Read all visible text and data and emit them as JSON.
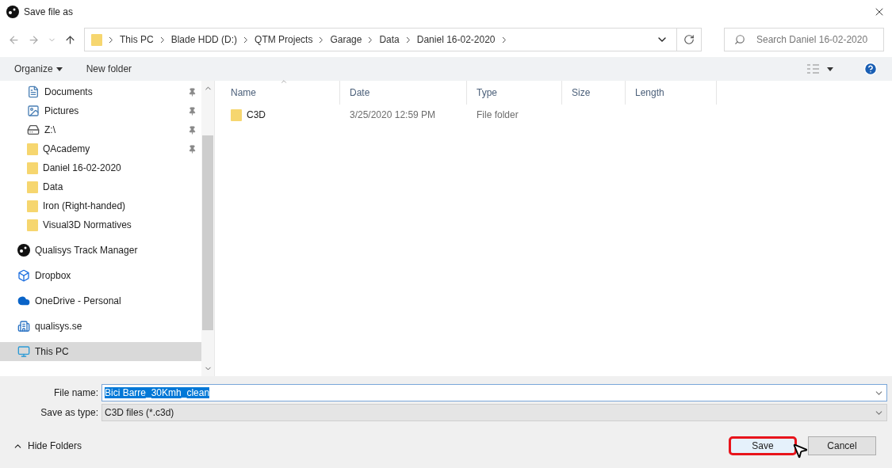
{
  "window": {
    "title": "Save file as"
  },
  "address": {
    "crumbs": [
      "This PC",
      "Blade HDD (D:)",
      "QTM Projects",
      "Garage",
      "Data",
      "Daniel 16-02-2020"
    ]
  },
  "search": {
    "placeholder": "Search Daniel 16-02-2020"
  },
  "toolbar": {
    "organize": "Organize",
    "new_folder": "New folder"
  },
  "sidebar": {
    "quick_access": [
      {
        "label": "Documents",
        "kind": "document",
        "pinned": true
      },
      {
        "label": "Pictures",
        "kind": "pictures",
        "pinned": true
      },
      {
        "label": "Z:\\",
        "kind": "drive",
        "pinned": true
      },
      {
        "label": "QAcademy",
        "kind": "folder",
        "pinned": true
      },
      {
        "label": "Daniel 16-02-2020",
        "kind": "folder",
        "pinned": false
      },
      {
        "label": "Data",
        "kind": "folder",
        "pinned": false
      },
      {
        "label": "Iron (Right-handed)",
        "kind": "folder",
        "pinned": false
      },
      {
        "label": "Visual3D Normatives",
        "kind": "folder",
        "pinned": false
      }
    ],
    "locations": [
      {
        "label": "Qualisys Track Manager",
        "kind": "app",
        "selected": false
      },
      {
        "label": "Dropbox",
        "kind": "dropbox",
        "selected": false
      },
      {
        "label": "OneDrive - Personal",
        "kind": "cloud",
        "selected": false
      },
      {
        "label": "qualisys.se",
        "kind": "site",
        "selected": false
      },
      {
        "label": "This PC",
        "kind": "pc",
        "selected": true
      }
    ]
  },
  "file_list": {
    "columns": [
      "Name",
      "Date",
      "Type",
      "Size",
      "Length"
    ],
    "rows": [
      {
        "name": "C3D",
        "date": "3/25/2020 12:59 PM",
        "type": "File folder"
      }
    ]
  },
  "form": {
    "file_name_label": "File name:",
    "file_name": "Bici Barre_30Kmh_clean",
    "type_label": "Save as type:",
    "type": "C3D files (*.c3d)"
  },
  "hide_folders": "Hide Folders",
  "buttons": [
    {
      "label": "Save",
      "highlighted": true
    },
    {
      "label": "Cancel",
      "highlighted": false
    }
  ]
}
